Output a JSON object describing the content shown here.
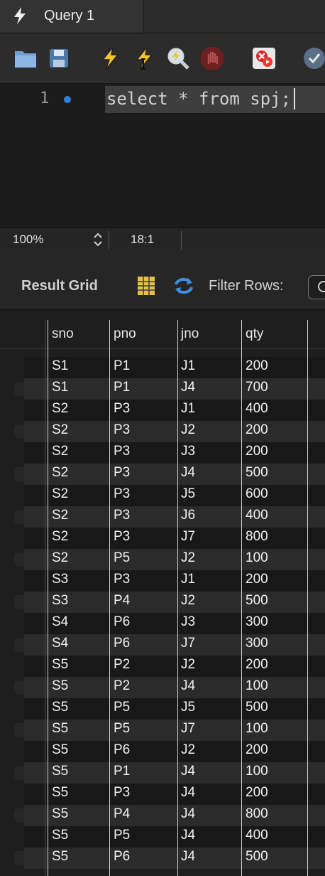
{
  "tab": {
    "title": "Query 1"
  },
  "toolbar": {
    "buttons": [
      "open-file",
      "save",
      "execute",
      "execute-current",
      "explain",
      "stop",
      "toggle-error",
      "commit"
    ]
  },
  "editor": {
    "line_number": "1",
    "code": "select * from spj;"
  },
  "status": {
    "zoom": "100%",
    "cursor_position": "18:1"
  },
  "result": {
    "title": "Result Grid",
    "filter_label": "Filter Rows:"
  },
  "grid": {
    "columns": [
      "sno",
      "pno",
      "jno",
      "qty"
    ],
    "rows": [
      [
        "S1",
        "P1",
        "J1",
        "200"
      ],
      [
        "S1",
        "P1",
        "J4",
        "700"
      ],
      [
        "S2",
        "P3",
        "J1",
        "400"
      ],
      [
        "S2",
        "P3",
        "J2",
        "200"
      ],
      [
        "S2",
        "P3",
        "J3",
        "200"
      ],
      [
        "S2",
        "P3",
        "J4",
        "500"
      ],
      [
        "S2",
        "P3",
        "J5",
        "600"
      ],
      [
        "S2",
        "P3",
        "J6",
        "400"
      ],
      [
        "S2",
        "P3",
        "J7",
        "800"
      ],
      [
        "S2",
        "P5",
        "J2",
        "100"
      ],
      [
        "S3",
        "P3",
        "J1",
        "200"
      ],
      [
        "S3",
        "P4",
        "J2",
        "500"
      ],
      [
        "S4",
        "P6",
        "J3",
        "300"
      ],
      [
        "S4",
        "P6",
        "J7",
        "300"
      ],
      [
        "S5",
        "P2",
        "J2",
        "200"
      ],
      [
        "S5",
        "P2",
        "J4",
        "100"
      ],
      [
        "S5",
        "P5",
        "J5",
        "500"
      ],
      [
        "S5",
        "P5",
        "J7",
        "100"
      ],
      [
        "S5",
        "P6",
        "J2",
        "200"
      ],
      [
        "S5",
        "P1",
        "J4",
        "100"
      ],
      [
        "S5",
        "P3",
        "J4",
        "200"
      ],
      [
        "S5",
        "P4",
        "J4",
        "800"
      ],
      [
        "S5",
        "P5",
        "J4",
        "400"
      ],
      [
        "S5",
        "P6",
        "J4",
        "500"
      ]
    ]
  }
}
